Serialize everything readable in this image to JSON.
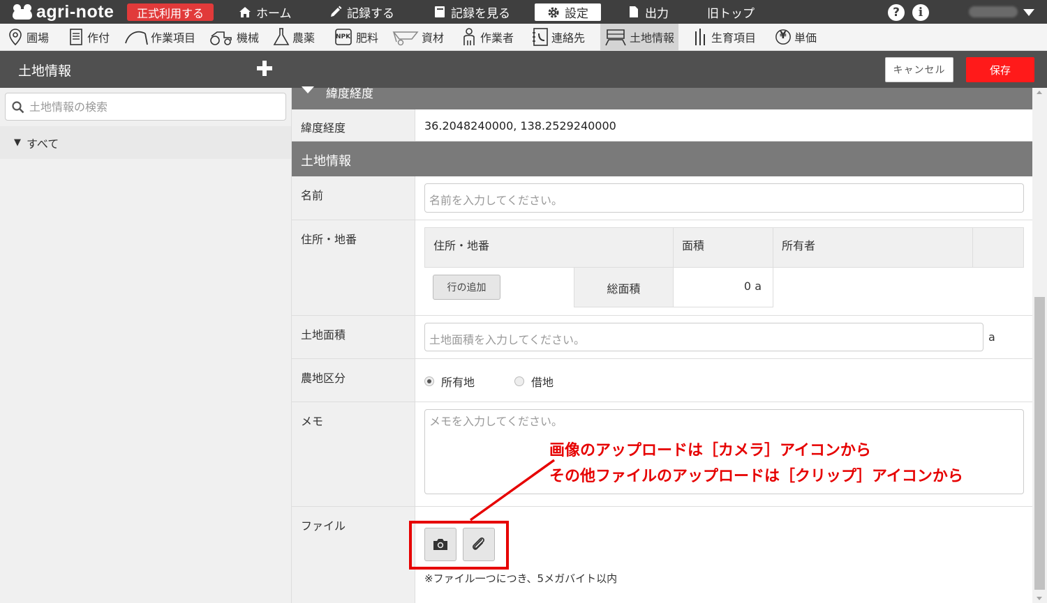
{
  "app": {
    "logo_text": "agri-note",
    "plan_badge": "正式利用する"
  },
  "topnav": {
    "home": "ホーム",
    "record": "記録する",
    "view_records": "記録を見る",
    "settings": "設定",
    "export": "出力",
    "old_top": "旧トップ",
    "help_icon": "?",
    "info_icon": "i"
  },
  "menu": {
    "items": [
      {
        "label": "圃場",
        "icon": "pin-icon"
      },
      {
        "label": "作付",
        "icon": "document-icon"
      },
      {
        "label": "作業項目",
        "icon": "sickle-icon"
      },
      {
        "label": "機械",
        "icon": "tractor-icon"
      },
      {
        "label": "農薬",
        "icon": "flask-icon"
      },
      {
        "label": "肥料",
        "icon": "fertilizer-bag-icon"
      },
      {
        "label": "資材",
        "icon": "wheelbarrow-icon"
      },
      {
        "label": "作業者",
        "icon": "person-icon"
      },
      {
        "label": "連絡先",
        "icon": "phone-book-icon"
      },
      {
        "label": "土地情報",
        "icon": "land-icon"
      },
      {
        "label": "生育項目",
        "icon": "grass-icon"
      },
      {
        "label": "単価",
        "icon": "yen-icon"
      }
    ],
    "fertilizer_icon_text": "NPK",
    "yen_symbol": "¥"
  },
  "header": {
    "title": "土地情報",
    "cancel_label": "キャンセル",
    "save_label": "保存"
  },
  "sidebar": {
    "search_placeholder": "土地情報の検索",
    "tree_all": "すべて",
    "tree_toggle": "▼"
  },
  "main": {
    "latlng_section": "緯度経度",
    "latlng_label": "緯度経度",
    "latlng_value": "36.2048240000, 138.2529240000",
    "land_section": "土地情報",
    "name_label": "名前",
    "name_placeholder": "名前を入力してください。",
    "address_label": "住所・地番",
    "address_table": {
      "col_address": "住所・地番",
      "col_area": "面積",
      "col_owner": "所有者",
      "add_row_button": "行の追加",
      "total_area_label": "総面積",
      "total_area_value": "0 a"
    },
    "land_area_label": "土地面積",
    "land_area_placeholder": "土地面積を入力してください。",
    "land_area_unit": "a",
    "farmland_type_label": "農地区分",
    "farmland_type_options": [
      "所有地",
      "借地"
    ],
    "farmland_type_selected": "所有地",
    "memo_label": "メモ",
    "memo_placeholder": "メモを入力してください。",
    "file_label": "ファイル",
    "file_note": "※ファイル一つにつき、5メガバイト以内"
  },
  "annotation": {
    "line1": "画像のアップロードは［カメラ］アイコンから",
    "line2": "その他ファイルのアップロードは［クリップ］アイコンから"
  },
  "colors": {
    "topbar": "#3f3f3f",
    "header": "#505050",
    "section": "#7a7a7a",
    "save": "#ff1a1a",
    "badge": "#e13a3a",
    "annotation": "#e60000"
  }
}
